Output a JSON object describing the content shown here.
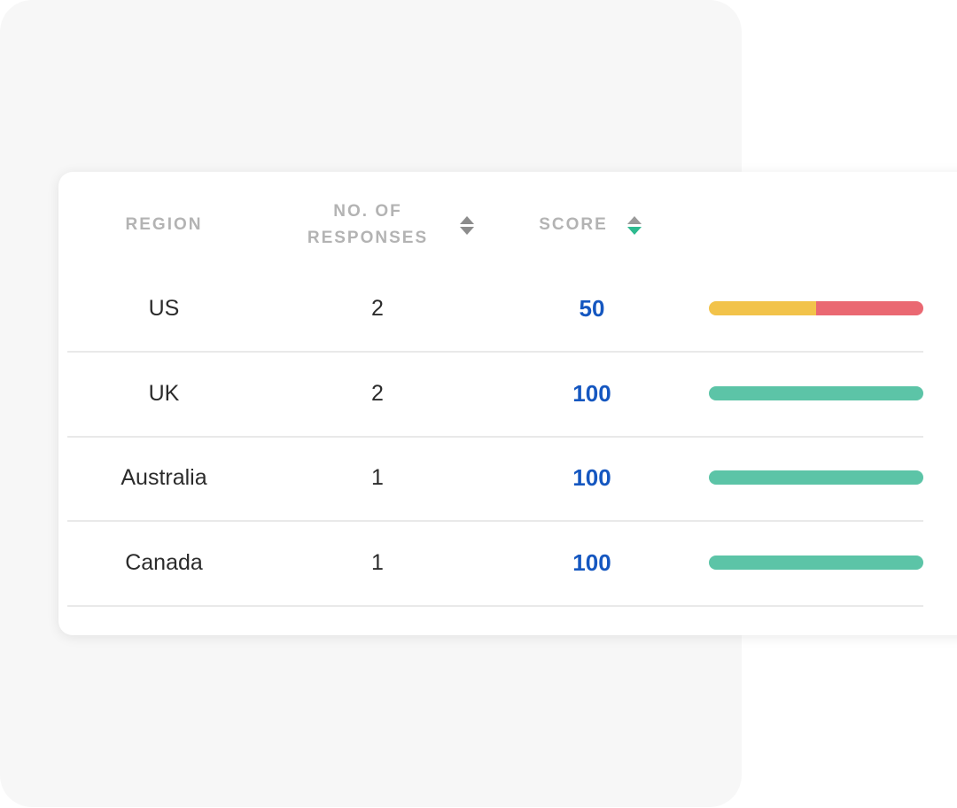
{
  "table": {
    "headers": {
      "region": "REGION",
      "responses_line1": "NO. OF",
      "responses_line2": "RESPONSES",
      "score": "SCORE"
    },
    "sort": {
      "active_column": "score",
      "direction": "descending"
    },
    "rows": [
      {
        "region": "US",
        "responses": "2",
        "score": "50",
        "bar": [
          {
            "fraction": 0.5,
            "color": "#f2c34a"
          },
          {
            "fraction": 0.5,
            "color": "#ea6872"
          }
        ]
      },
      {
        "region": "UK",
        "responses": "2",
        "score": "100",
        "bar": [
          {
            "fraction": 1.0,
            "color": "#5cc4a7"
          }
        ]
      },
      {
        "region": "Australia",
        "responses": "1",
        "score": "100",
        "bar": [
          {
            "fraction": 1.0,
            "color": "#5cc4a7"
          }
        ]
      },
      {
        "region": "Canada",
        "responses": "1",
        "score": "100",
        "bar": [
          {
            "fraction": 1.0,
            "color": "#5cc4a7"
          }
        ]
      }
    ]
  },
  "colors": {
    "score_text": "#1557c0",
    "sort_active": "#2dba8f",
    "header_text": "#b3b3b3"
  }
}
